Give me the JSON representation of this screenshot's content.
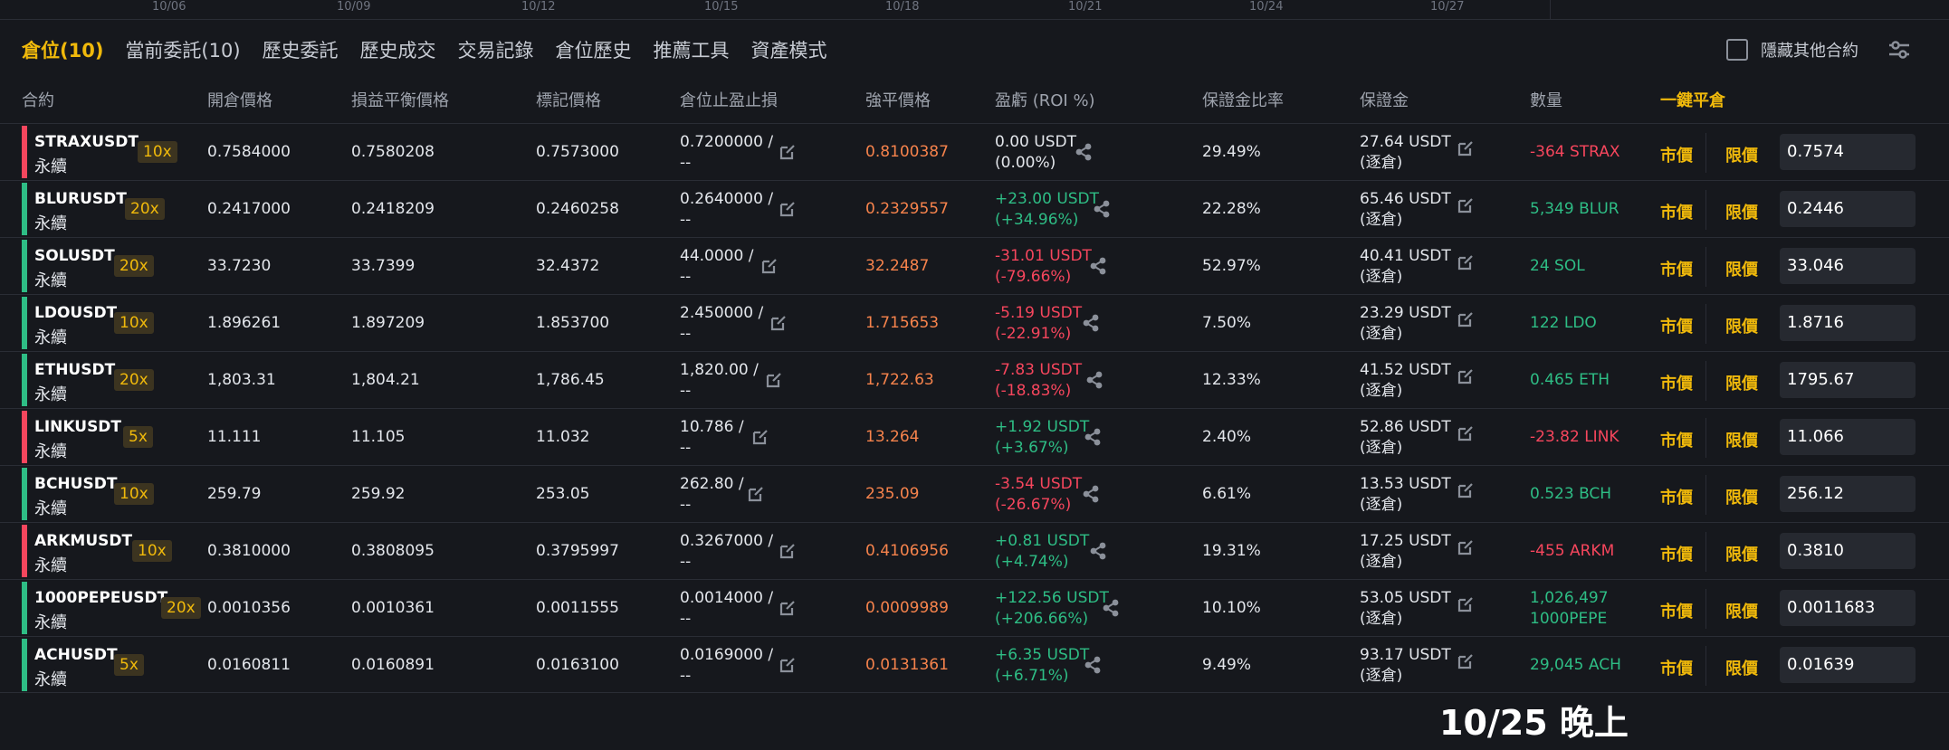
{
  "axis": {
    "ticks": [
      "10/06",
      "10/09",
      "10/12",
      "10/15",
      "10/18",
      "10/21",
      "10/24",
      "10/27"
    ]
  },
  "tabs": [
    {
      "label": "倉位(10)",
      "active": true
    },
    {
      "label": "當前委託(10)"
    },
    {
      "label": "歷史委託"
    },
    {
      "label": "歷史成交"
    },
    {
      "label": "交易記錄"
    },
    {
      "label": "倉位歷史"
    },
    {
      "label": "推薦工具"
    },
    {
      "label": "資產模式"
    }
  ],
  "hide_other": "隱藏其他合約",
  "columns": {
    "contract": "合約",
    "entry": "開倉價格",
    "breakeven": "損益平衡價格",
    "mark": "標記價格",
    "tpsl": "倉位止盈止損",
    "liq": "強平價格",
    "pnl": "盈虧 (ROI %)",
    "margin_ratio": "保證金比率",
    "margin": "保證金",
    "qty": "數量",
    "close_all": "一鍵平倉"
  },
  "labels": {
    "perpetual": "永續",
    "market": "市價",
    "limit": "限價"
  },
  "colors": {
    "accent": "#f0b90b",
    "profit": "#2ebd85",
    "loss": "#f6465d",
    "liq": "#f6834c"
  },
  "positions": [
    {
      "symbol": "STRAXUSDT",
      "leverage": "10x",
      "side": "short",
      "entry": "0.7584000",
      "breakeven": "0.7580208",
      "mark": "0.7573000",
      "tp": "0.7200000 /",
      "sl": "--",
      "liq": "0.8100387",
      "pnl": "0.00 USDT",
      "roi": "(0.00%)",
      "pnl_sign": "neu",
      "margin_ratio": "29.49%",
      "margin": "27.64 USDT",
      "margin_mode": "(逐倉)",
      "qty": "-364 STRAX",
      "limit_price": "0.7574"
    },
    {
      "symbol": "BLURUSDT",
      "leverage": "20x",
      "side": "long",
      "entry": "0.2417000",
      "breakeven": "0.2418209",
      "mark": "0.2460258",
      "tp": "0.2640000 /",
      "sl": "--",
      "liq": "0.2329557",
      "pnl": "+23.00 USDT",
      "roi": "(+34.96%)",
      "pnl_sign": "pos",
      "margin_ratio": "22.28%",
      "margin": "65.46 USDT",
      "margin_mode": "(逐倉)",
      "qty": "5,349 BLUR",
      "limit_price": "0.2446"
    },
    {
      "symbol": "SOLUSDT",
      "leverage": "20x",
      "side": "long",
      "entry": "33.7230",
      "breakeven": "33.7399",
      "mark": "32.4372",
      "tp": "44.0000 /",
      "sl": "--",
      "liq": "32.2487",
      "pnl": "-31.01 USDT",
      "roi": "(-79.66%)",
      "pnl_sign": "neg",
      "margin_ratio": "52.97%",
      "margin": "40.41 USDT",
      "margin_mode": "(逐倉)",
      "qty": "24 SOL",
      "limit_price": "33.046"
    },
    {
      "symbol": "LDOUSDT",
      "leverage": "10x",
      "side": "long",
      "entry": "1.896261",
      "breakeven": "1.897209",
      "mark": "1.853700",
      "tp": "2.450000 /",
      "sl": "--",
      "liq": "1.715653",
      "pnl": "-5.19 USDT",
      "roi": "(-22.91%)",
      "pnl_sign": "neg",
      "margin_ratio": "7.50%",
      "margin": "23.29 USDT",
      "margin_mode": "(逐倉)",
      "qty": "122 LDO",
      "limit_price": "1.8716"
    },
    {
      "symbol": "ETHUSDT",
      "leverage": "20x",
      "side": "long",
      "entry": "1,803.31",
      "breakeven": "1,804.21",
      "mark": "1,786.45",
      "tp": "1,820.00 /",
      "sl": "--",
      "liq": "1,722.63",
      "pnl": "-7.83 USDT",
      "roi": "(-18.83%)",
      "pnl_sign": "neg",
      "margin_ratio": "12.33%",
      "margin": "41.52 USDT",
      "margin_mode": "(逐倉)",
      "qty": "0.465 ETH",
      "limit_price": "1795.67"
    },
    {
      "symbol": "LINKUSDT",
      "leverage": "5x",
      "side": "short",
      "entry": "11.111",
      "breakeven": "11.105",
      "mark": "11.032",
      "tp": "10.786 /",
      "sl": "--",
      "liq": "13.264",
      "pnl": "+1.92 USDT",
      "roi": "(+3.67%)",
      "pnl_sign": "pos",
      "margin_ratio": "2.40%",
      "margin": "52.86 USDT",
      "margin_mode": "(逐倉)",
      "qty": "-23.82 LINK",
      "limit_price": "11.066"
    },
    {
      "symbol": "BCHUSDT",
      "leverage": "10x",
      "side": "long",
      "entry": "259.79",
      "breakeven": "259.92",
      "mark": "253.05",
      "tp": "262.80 /",
      "sl": "--",
      "liq": "235.09",
      "pnl": "-3.54 USDT",
      "roi": "(-26.67%)",
      "pnl_sign": "neg",
      "margin_ratio": "6.61%",
      "margin": "13.53 USDT",
      "margin_mode": "(逐倉)",
      "qty": "0.523 BCH",
      "limit_price": "256.12"
    },
    {
      "symbol": "ARKMUSDT",
      "leverage": "10x",
      "side": "short",
      "entry": "0.3810000",
      "breakeven": "0.3808095",
      "mark": "0.3795997",
      "tp": "0.3267000 /",
      "sl": "--",
      "liq": "0.4106956",
      "pnl": "+0.81 USDT",
      "roi": "(+4.74%)",
      "pnl_sign": "pos",
      "margin_ratio": "19.31%",
      "margin": "17.25 USDT",
      "margin_mode": "(逐倉)",
      "qty": "-455 ARKM",
      "limit_price": "0.3810"
    },
    {
      "symbol": "1000PEPEUSDT",
      "leverage": "20x",
      "side": "long",
      "entry": "0.0010356",
      "breakeven": "0.0010361",
      "mark": "0.0011555",
      "tp": "0.0014000 /",
      "sl": "--",
      "liq": "0.0009989",
      "pnl": "+122.56 USDT",
      "roi": "(+206.66%)",
      "pnl_sign": "pos",
      "margin_ratio": "10.10%",
      "margin": "53.05 USDT",
      "margin_mode": "(逐倉)",
      "qty": "1,026,497",
      "qty2": "1000PEPE",
      "limit_price": "0.0011683"
    },
    {
      "symbol": "ACHUSDT",
      "leverage": "5x",
      "side": "long",
      "entry": "0.0160811",
      "breakeven": "0.0160891",
      "mark": "0.0163100",
      "tp": "0.0169000 /",
      "sl": "--",
      "liq": "0.0131361",
      "pnl": "+6.35 USDT",
      "roi": "(+6.71%)",
      "pnl_sign": "pos",
      "margin_ratio": "9.49%",
      "margin": "93.17 USDT",
      "margin_mode": "(逐倉)",
      "qty": "29,045 ACH",
      "limit_price": "0.01639"
    }
  ],
  "caption": "10/25 晚上"
}
